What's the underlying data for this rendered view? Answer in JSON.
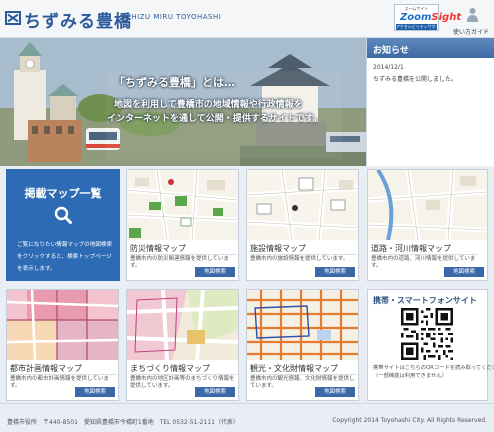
{
  "header": {
    "site_title": "ちずみる豊橋",
    "site_subtitle": "CHIZU MIRU TOYOHASHI",
    "zoom_badge": {
      "top_text": "ズームサイト",
      "word_main": "Zoom",
      "word_accent": "Sight",
      "bottom_text": "アクセシビリティサポーター"
    },
    "guide_label": "使い方ガイド"
  },
  "hero": {
    "title": "「ちずみる豊橋」とは…",
    "line1": "地図を利用して豊橋市の地域情報や行政情報を",
    "line2": "インターネットを通して公開・提供するサイトです。"
  },
  "notice": {
    "heading": "お知らせ",
    "date": "2014/12/1",
    "text": "ちずみる豊橋を公開しました。"
  },
  "intro": {
    "title": "掲載マップ一覧",
    "text": "ご覧になりたい情報マップの地図検索をクリックすると、検索トップページを表示します。"
  },
  "maps": [
    {
      "title": "防災情報マップ",
      "desc": "豊橋市内の防災関連情報を提供しています。",
      "button": "地図検索"
    },
    {
      "title": "施設情報マップ",
      "desc": "豊橋市内の施設情報を提供しています。",
      "button": "地図検索"
    },
    {
      "title": "道路・河川情報マップ",
      "desc": "豊橋市内の道路、河川情報を提供しています。",
      "button": "地図検索"
    },
    {
      "title": "都市計画情報マップ",
      "desc": "豊橋市内の都市計画情報を提供しています。",
      "button": "地図検索"
    },
    {
      "title": "まちづくり情報マップ",
      "desc": "豊橋市内の地区計画等のまちづくり情報を提供しています。",
      "button": "地図検索"
    },
    {
      "title": "観光・文化財情報マップ",
      "desc": "豊橋市内の観光情報、文化財情報を提供しています。",
      "button": "地図検索"
    }
  ],
  "mobile": {
    "title": "携帯・スマートフォンサイト",
    "text1": "携帯サイトはこちらのQRコードを読み取ってください。",
    "text2": "（一部機能は利用できません）"
  },
  "footer": {
    "address": "豊橋市役所　〒440-8501　愛知県豊橋市今橋町1番地　TEL 0532-51-2111（代表）",
    "copyright": "Copyright 2014 Toyohashi City. All Rights Reserved."
  },
  "colors": {
    "brand_blue": "#2b5a9a",
    "panel_blue": "#2d6bb5",
    "button_blue": "#3a68a8"
  }
}
